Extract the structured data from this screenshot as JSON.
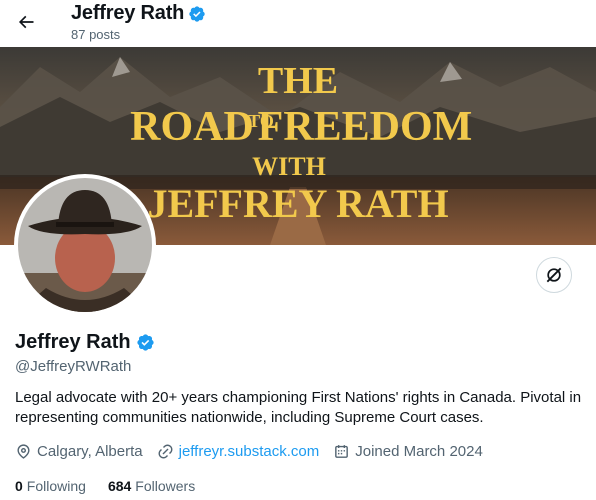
{
  "header": {
    "display_name": "Jeffrey Rath",
    "post_count": "87 posts"
  },
  "banner": {
    "line1": "THE",
    "line2a": "ROAD",
    "line2b": "TO",
    "line2c": "FREEDOM",
    "line3": "WITH",
    "line4": "JEFFREY RATH"
  },
  "profile": {
    "display_name": "Jeffrey Rath",
    "handle": "@JeffreyRWRath",
    "bio": "Legal advocate with 20+ years championing First Nations' rights in Canada. Pivotal in representing communities nationwide, including Supreme Court cases.",
    "location": "Calgary, Alberta",
    "website": "jeffreyr.substack.com",
    "joined": "Joined March 2024"
  },
  "stats": {
    "following_count": "0",
    "following_label": "Following",
    "followers_count": "684",
    "followers_label": "Followers"
  },
  "colors": {
    "verified": "#1d9bf0",
    "link": "#1d9bf0",
    "banner_text": "#f2c94c"
  },
  "icons": {
    "back": "arrow-left-icon",
    "verified": "verified-badge-icon",
    "follow_toggle": "grok-slash-icon",
    "location": "location-pin-icon",
    "link": "link-icon",
    "calendar": "calendar-icon"
  }
}
